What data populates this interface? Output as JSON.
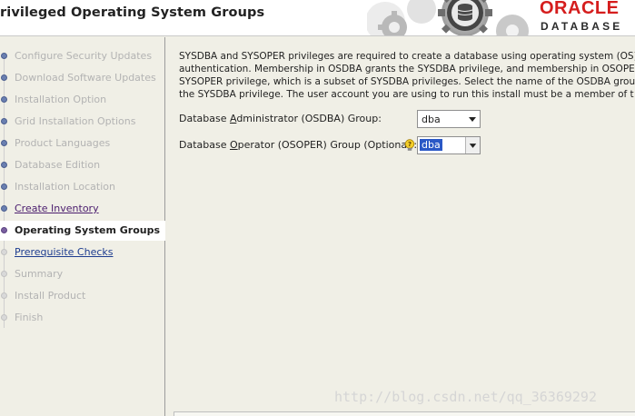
{
  "header": {
    "title": "rivileged Operating System Groups",
    "brand_name": "ORACLE",
    "brand_product": "DATABASE"
  },
  "sidebar": {
    "steps": [
      {
        "label": "Configure Security Updates",
        "state": "disabled"
      },
      {
        "label": "Download Software Updates",
        "state": "disabled"
      },
      {
        "label": "Installation Option",
        "state": "disabled"
      },
      {
        "label": "Grid Installation Options",
        "state": "disabled"
      },
      {
        "label": "Product Languages",
        "state": "disabled"
      },
      {
        "label": "Database Edition",
        "state": "disabled"
      },
      {
        "label": "Installation Location",
        "state": "disabled"
      },
      {
        "label": "Create Inventory",
        "state": "visited"
      },
      {
        "label": "Operating System Groups",
        "state": "current"
      },
      {
        "label": "Prerequisite Checks",
        "state": "link"
      },
      {
        "label": "Summary",
        "state": "disabled"
      },
      {
        "label": "Install Product",
        "state": "disabled"
      },
      {
        "label": "Finish",
        "state": "disabled"
      }
    ]
  },
  "main": {
    "description_lines": [
      "SYSDBA and SYSOPER privileges are required to create a database using operating system (OS)",
      "authentication. Membership in OSDBA grants the SYSDBA privilege, and membership in OSOPER",
      "SYSOPER privilege, which is a subset of SYSDBA privileges. Select the name of the OSDBA group",
      "the SYSDBA privilege. The user account you are using to run this install must be a member of t"
    ],
    "osdba": {
      "label_pre": "Database ",
      "label_access": "A",
      "label_post": "dministrator (OSDBA) Group:",
      "value": "dba"
    },
    "osoper": {
      "label_pre": "Database ",
      "label_access": "O",
      "label_post": "perator (OSOPER) Group (Optional):",
      "value": "dba"
    }
  },
  "watermark": "http://blog.csdn.net/qq_36369292",
  "colors": {
    "accent_red": "#d51d1d",
    "current_step_bg": "#ffffff",
    "selection_blue": "#2a58c6"
  }
}
